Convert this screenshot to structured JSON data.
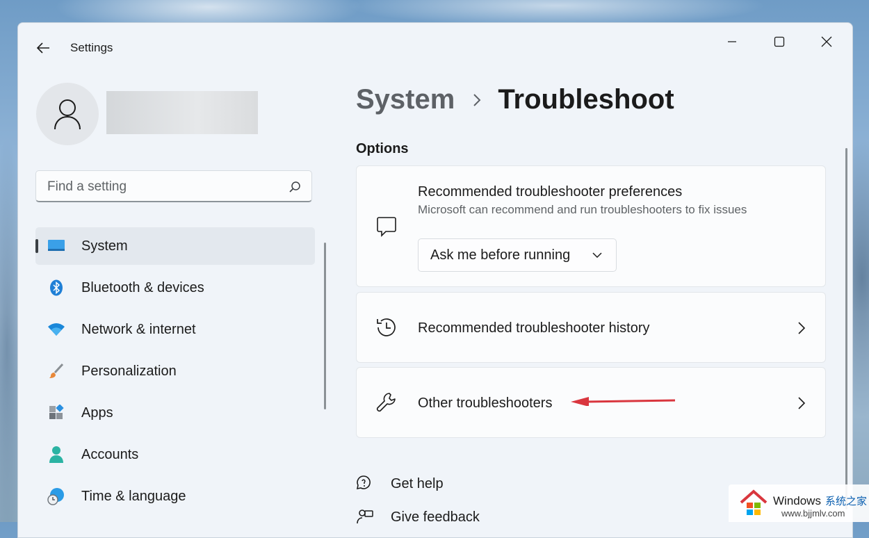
{
  "window": {
    "title": "Settings"
  },
  "search": {
    "placeholder": "Find a setting"
  },
  "sidebar": {
    "items": [
      {
        "label": "System",
        "icon": "monitor-icon",
        "active": true
      },
      {
        "label": "Bluetooth & devices",
        "icon": "bluetooth-icon"
      },
      {
        "label": "Network & internet",
        "icon": "wifi-icon"
      },
      {
        "label": "Personalization",
        "icon": "brush-icon"
      },
      {
        "label": "Apps",
        "icon": "apps-icon"
      },
      {
        "label": "Accounts",
        "icon": "person-icon"
      },
      {
        "label": "Time & language",
        "icon": "globe-clock-icon"
      }
    ]
  },
  "breadcrumb": {
    "parent": "System",
    "current": "Troubleshoot"
  },
  "options": {
    "title": "Options",
    "preferences": {
      "title": "Recommended troubleshooter preferences",
      "subtitle": "Microsoft can recommend and run troubleshooters to fix issues",
      "dropdown_value": "Ask me before running"
    },
    "history": {
      "title": "Recommended troubleshooter history"
    },
    "other": {
      "title": "Other troubleshooters"
    }
  },
  "links": {
    "get_help": "Get help",
    "give_feedback": "Give feedback"
  },
  "watermark": {
    "title": "Windows",
    "title_cn": "系统之家",
    "url": "www.bjjmlv.com"
  },
  "colors": {
    "accent_arrow": "#d9363e",
    "window_bg": "#f0f4f9",
    "card_bg": "#fbfcfd"
  }
}
